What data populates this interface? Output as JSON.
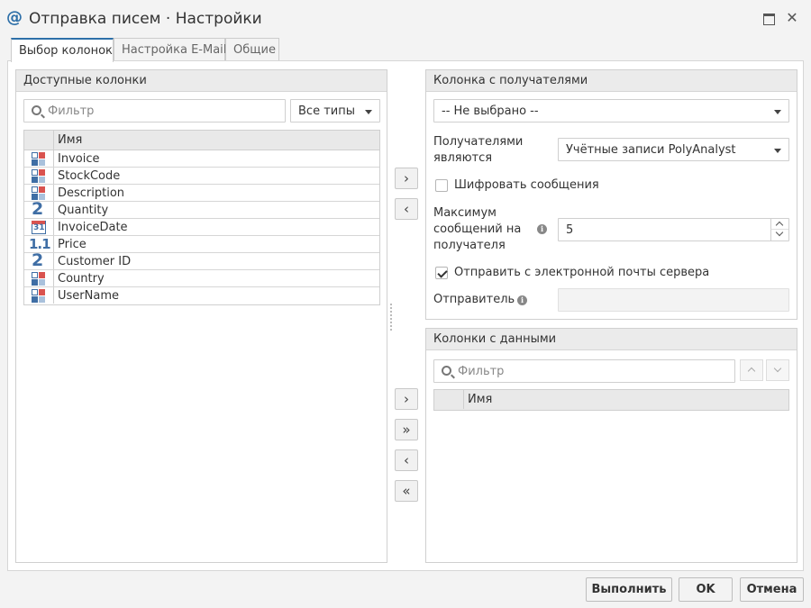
{
  "window": {
    "icon": "at-icon",
    "icon_glyph": "@",
    "title": "Отправка писем · Настройки",
    "close_glyph": "✕"
  },
  "tabs": [
    {
      "label": "Выбор колонок",
      "active": true
    },
    {
      "label": "Настройка E-Mail",
      "active": false
    },
    {
      "label": "Общие",
      "active": false
    }
  ],
  "available_columns": {
    "header": "Доступные колонки",
    "filter_placeholder": "Фильтр",
    "type_filter": "Все типы",
    "grid_header": "Имя",
    "rows": [
      {
        "name": "Invoice",
        "type": "string"
      },
      {
        "name": "StockCode",
        "type": "string"
      },
      {
        "name": "Description",
        "type": "string"
      },
      {
        "name": "Quantity",
        "type": "integer",
        "glyph": "2"
      },
      {
        "name": "InvoiceDate",
        "type": "date",
        "glyph": "31"
      },
      {
        "name": "Price",
        "type": "float",
        "glyph": "1.1"
      },
      {
        "name": "Customer ID",
        "type": "integer",
        "glyph": "2"
      },
      {
        "name": "Country",
        "type": "string"
      },
      {
        "name": "UserName",
        "type": "string"
      }
    ]
  },
  "move_buttons": {
    "add": "›",
    "remove": "‹",
    "add_all": "»",
    "remove_all": "«"
  },
  "recipients": {
    "header": "Колонка с получателями",
    "column_select": "-- Не выбрано --",
    "recipients_are_label": "Получателями являются",
    "recipients_are_value": "Учётные записи PolyAnalyst",
    "encrypt_label": "Шифровать сообщения",
    "encrypt_checked": false,
    "max_messages_label": "Максимум сообщений на получателя",
    "max_messages_value": "5",
    "send_from_server_label": "Отправить с электронной почты сервера",
    "send_from_server_checked": true,
    "sender_label": "Отправитель",
    "sender_value": ""
  },
  "data_columns": {
    "header": "Колонки с данными",
    "filter_placeholder": "Фильтр",
    "grid_header": "Имя"
  },
  "footer": {
    "run": "Выполнить",
    "ok": "OK",
    "cancel": "Отмена"
  }
}
